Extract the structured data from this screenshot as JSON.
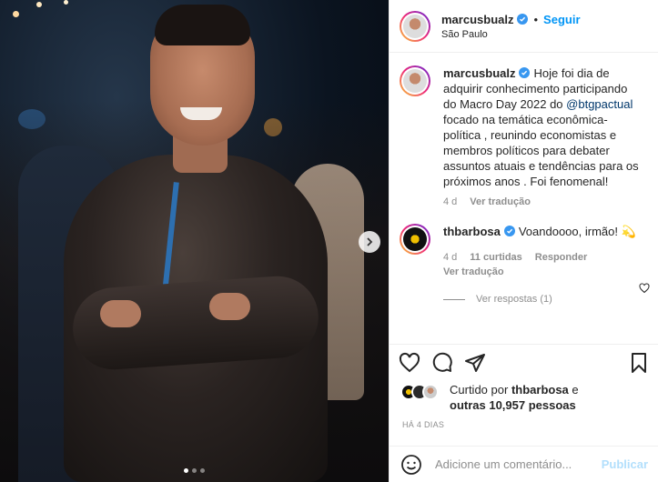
{
  "post": {
    "author": "marcusbualz",
    "location": "São Paulo",
    "follow_label": "Seguir",
    "separator": "•",
    "caption": "Hoje foi dia de adquirir conhecimento participando do Macro Day 2022 do",
    "caption_mention": "@btgpactual",
    "caption_rest": "focado na temática econômica-política , reunindo economistas e membros políticos para debater assuntos atuais e tendências para os próximos anos . Foi fenomenal!",
    "caption_age": "4 d",
    "translate_label": "Ver tradução"
  },
  "comment": {
    "author": "thbarbosa",
    "text": "Voandoooo, irmão! 💫",
    "age": "4 d",
    "likes": "11 curtidas",
    "reply_label": "Responder",
    "translate_label": "Ver tradução",
    "view_replies": "Ver respostas (1)"
  },
  "likes": {
    "prefix": "Curtido por",
    "first_user": "thbarbosa",
    "connector": "e",
    "others": "outras 10,957 pessoas",
    "time_ago": "HÁ 4 DIAS"
  },
  "add_comment": {
    "placeholder": "Adicione um comentário...",
    "publish_label": "Publicar"
  },
  "carousel": {
    "total": 3,
    "active": 0
  },
  "colors": {
    "accent": "#0095f6",
    "verified": "#3897f0"
  }
}
